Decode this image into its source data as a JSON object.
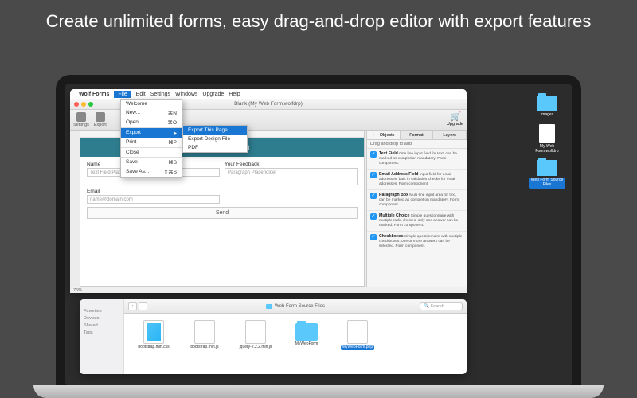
{
  "tagline": "Create unlimited forms, easy drag-and-drop editor with export features",
  "menubar": {
    "appname": "Wolf Forms",
    "items": [
      "File",
      "Edit",
      "Settings",
      "Windows",
      "Upgrade",
      "Help"
    ],
    "active": "File"
  },
  "window_title": "Blank (My Web Form.wolfdrp)",
  "toolbar": {
    "settings": "Settings",
    "export": "Export",
    "upgrade": "Upgrade"
  },
  "file_menu": [
    {
      "label": "Welcome"
    },
    {
      "label": "New...",
      "sc": "⌘N"
    },
    {
      "label": "Open...",
      "sc": "⌘O"
    },
    {
      "label": "Export",
      "hi": true,
      "arrow": "▸",
      "sep": true
    },
    {
      "label": "Print",
      "sc": "⌘P"
    },
    {
      "label": "Close",
      "sep": true
    },
    {
      "label": "Save",
      "sc": "⌘S",
      "sep": true
    },
    {
      "label": "Save As...",
      "sc": "⇧⌘S"
    }
  ],
  "export_submenu": [
    {
      "label": "Export This Page",
      "hi": true
    },
    {
      "label": "Export Design File"
    },
    {
      "label": "PDF",
      "sep": true
    }
  ],
  "form": {
    "title": "My Web Form",
    "name_label": "Name",
    "name_ph": "Text Field Placeholder",
    "feedback_label": "Your Feedback",
    "feedback_ph": "Paragraph Placeholder",
    "email_label": "Email",
    "email_ph": "name@domain.com",
    "send": "Send"
  },
  "status": "76%",
  "inspector": {
    "tabs": [
      "+ Objects",
      "Format",
      "Layers"
    ],
    "heading": "Drag and drop to add",
    "components": [
      {
        "name": "Text Field",
        "desc": "One line input field for text, can be marked as completion mandatory. Form component."
      },
      {
        "name": "Email Address Field",
        "desc": "Input field for email addresses, built in validation checks for email addresses. Form component."
      },
      {
        "name": "Paragraph Box",
        "desc": "Multi-line input area for text, can be marked as completion mandatory. Form component."
      },
      {
        "name": "Multiple Choice",
        "desc": "Simple questionnaire with multiple radio choices, only one answer can be marked. Form component."
      },
      {
        "name": "Checkboxes",
        "desc": "Simple questionnaire with multiple checkboxes, one or more answers can be selected. Form component."
      }
    ]
  },
  "desktop": [
    {
      "type": "folder",
      "label": "Images"
    },
    {
      "type": "file",
      "label": "My Web Form.wolfdrp"
    },
    {
      "type": "folder",
      "label": "Web Form Source Files",
      "sel": true
    }
  ],
  "finder": {
    "title": "Web Form Source Files",
    "sidebar": [
      "Favorites",
      "Devices",
      "Shared",
      "Tags"
    ],
    "search_ph": "Search",
    "files": [
      {
        "name": "bootstrap.min.css",
        "type": "css"
      },
      {
        "name": "bootstrap.min.js",
        "type": "file"
      },
      {
        "name": "jquery-2.2.2.min.js",
        "type": "file"
      },
      {
        "name": "MyWebForm",
        "type": "folder"
      },
      {
        "name": "MyWebForm.php",
        "type": "file",
        "sel": true
      }
    ]
  }
}
